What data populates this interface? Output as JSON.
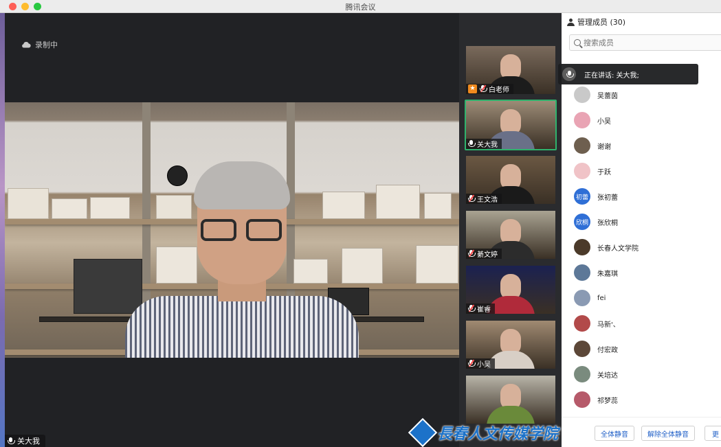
{
  "window": {
    "title": "腾讯会议"
  },
  "recording": {
    "label": "录制中"
  },
  "main_speaker": {
    "name": "关大我"
  },
  "gallery": [
    {
      "name": "白老师",
      "host": true,
      "muted": true,
      "active": false,
      "bg": "#7a6a5c",
      "shirt": "#1c1c1c"
    },
    {
      "name": "关大我",
      "host": false,
      "muted": false,
      "active": true,
      "bg": "#9c8b76",
      "shirt": "#6a7088"
    },
    {
      "name": "王文浩",
      "host": false,
      "muted": true,
      "active": false,
      "bg": "#6b5843",
      "shirt": "#1a1a1a"
    },
    {
      "name": "綦文婷",
      "host": false,
      "muted": true,
      "active": false,
      "bg": "#a9a392",
      "shirt": "#2c2c2c"
    },
    {
      "name": "崔睿",
      "host": false,
      "muted": true,
      "active": false,
      "bg": "#1b2150",
      "shirt": "#b02a3a"
    },
    {
      "name": "小吴",
      "host": false,
      "muted": true,
      "active": false,
      "bg": "#a08a72",
      "shirt": "#d8cfc6"
    },
    {
      "name": "",
      "host": false,
      "muted": false,
      "active": false,
      "bg": "#b8b4a8",
      "shirt": "#6a8a3a"
    }
  ],
  "panel": {
    "title": "管理成员 (30)",
    "search_placeholder": "搜索成员",
    "speaking_label": "正在讲话: 关大我;",
    "members": [
      {
        "name": "吴蕾茵",
        "avatar_text": "",
        "color": "#c9c9c9"
      },
      {
        "name": "小吴",
        "avatar_text": "",
        "color": "#e9a4b4"
      },
      {
        "name": "谢谢",
        "avatar_text": "",
        "color": "#6e5f4f"
      },
      {
        "name": "于跃",
        "avatar_text": "",
        "color": "#f0c3c7"
      },
      {
        "name": "张初蕾",
        "avatar_text": "初蕾",
        "color": "#2f6fd6"
      },
      {
        "name": "张欣桐",
        "avatar_text": "欣桐",
        "color": "#2f6fd6"
      },
      {
        "name": "长春人文学院",
        "avatar_text": "",
        "color": "#4b3a2a"
      },
      {
        "name": "朱嘉琪",
        "avatar_text": "",
        "color": "#5d7898"
      },
      {
        "name": "fei",
        "avatar_text": "",
        "color": "#8a9ab3"
      },
      {
        "name": "马新'、",
        "avatar_text": "",
        "color": "#b24a4a"
      },
      {
        "name": "付宏政",
        "avatar_text": "",
        "color": "#5c4738"
      },
      {
        "name": "关培达",
        "avatar_text": "",
        "color": "#7a8b7e"
      },
      {
        "name": "祁梦蕊",
        "avatar_text": "",
        "color": "#b65a6a"
      }
    ],
    "buttons": {
      "mute_all": "全体静音",
      "unmute_all": "解除全体静音",
      "more": "更"
    }
  },
  "watermark": {
    "text": "長春人文传媒学院"
  }
}
